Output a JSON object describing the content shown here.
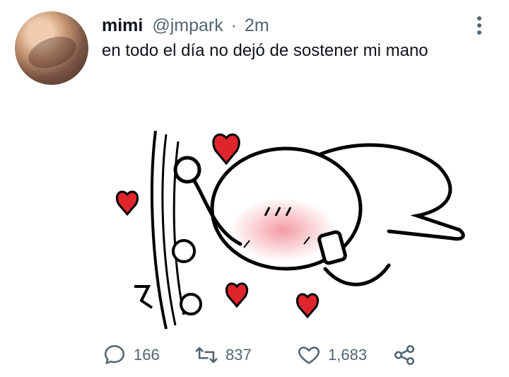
{
  "tweet": {
    "display_name": "mimi",
    "handle": "@jmpark",
    "separator": "·",
    "time": "2m",
    "text": "en todo el día no dejó de sostener mi mano"
  },
  "media": {
    "description_icon": "drawing-illustration"
  },
  "actions": {
    "reply_count": "166",
    "retweet_count": "837",
    "like_count": "1,683"
  },
  "colors": {
    "text": "#0f1419",
    "muted": "#536471",
    "heart_red": "#e0242b",
    "blush": "#f28a94"
  }
}
